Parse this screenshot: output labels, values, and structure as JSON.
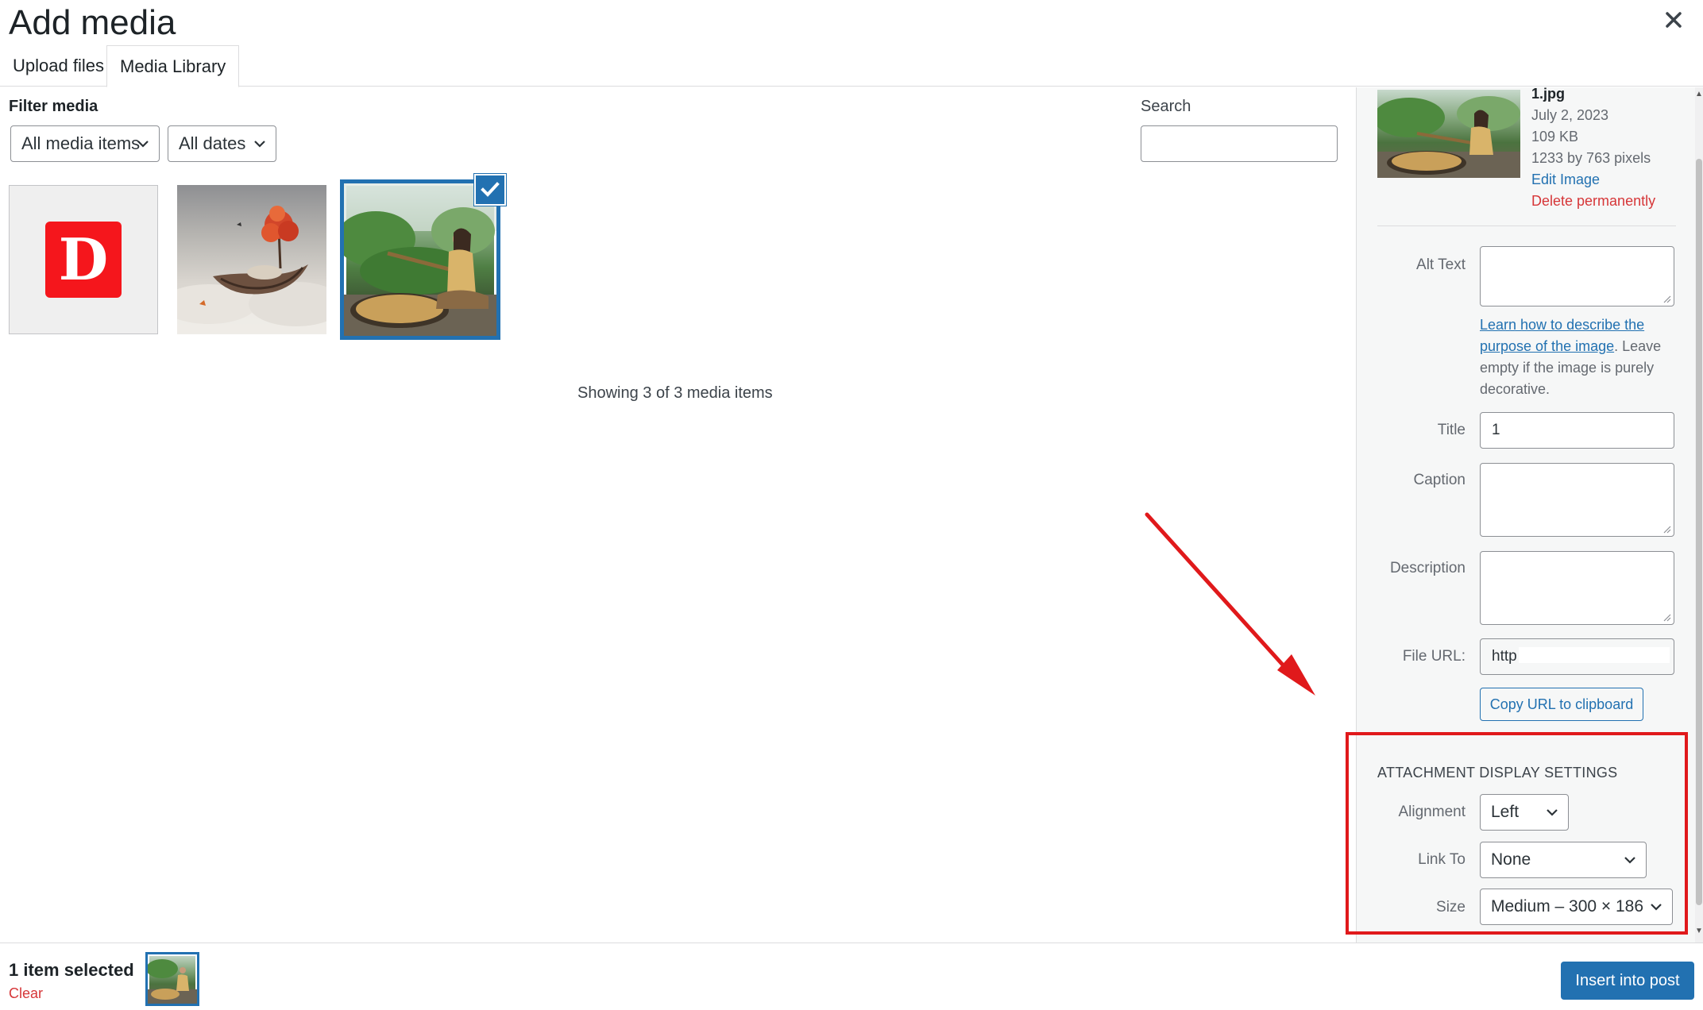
{
  "modal": {
    "title": "Add media",
    "close_icon": "close-icon"
  },
  "tabs": [
    {
      "label": "Upload files",
      "active": false
    },
    {
      "label": "Media Library",
      "active": true
    }
  ],
  "filter": {
    "label": "Filter media",
    "type_select": "All media items",
    "date_select": "All dates"
  },
  "search": {
    "label": "Search",
    "value": ""
  },
  "media_items": [
    {
      "name": "d-logo-thumbnail",
      "selected": false
    },
    {
      "name": "boat-clouds-thumbnail",
      "selected": false
    },
    {
      "name": "woman-sieve-thumbnail",
      "selected": true
    }
  ],
  "status": {
    "showing": "Showing 3 of 3 media items"
  },
  "details": {
    "filename": "1.jpg",
    "date": "July 2, 2023",
    "filesize": "109 KB",
    "dimensions": "1233 by 763 pixels",
    "edit_link": "Edit Image",
    "delete_link": "Delete permanently",
    "alt_text_label": "Alt Text",
    "alt_text_value": "",
    "help_link": "Learn how to describe the purpose of the image",
    "help_rest": ". Leave empty if the image is purely decorative.",
    "title_label": "Title",
    "title_value": "1",
    "caption_label": "Caption",
    "caption_value": "",
    "description_label": "Description",
    "description_value": "",
    "file_url_label": "File URL:",
    "file_url_value": "http",
    "copy_button": "Copy URL to clipboard"
  },
  "display_settings": {
    "heading": "Attachment Display Settings",
    "alignment_label": "Alignment",
    "alignment_value": "Left",
    "link_to_label": "Link To",
    "link_to_value": "None",
    "size_label": "Size",
    "size_value": "Medium – 300 × 186"
  },
  "footer": {
    "selected_count": "1 item selected",
    "clear_label": "Clear",
    "insert_button": "Insert into post"
  },
  "colors": {
    "accent": "#2271b1",
    "danger": "#d63638",
    "highlight_red": "#e0191b"
  }
}
